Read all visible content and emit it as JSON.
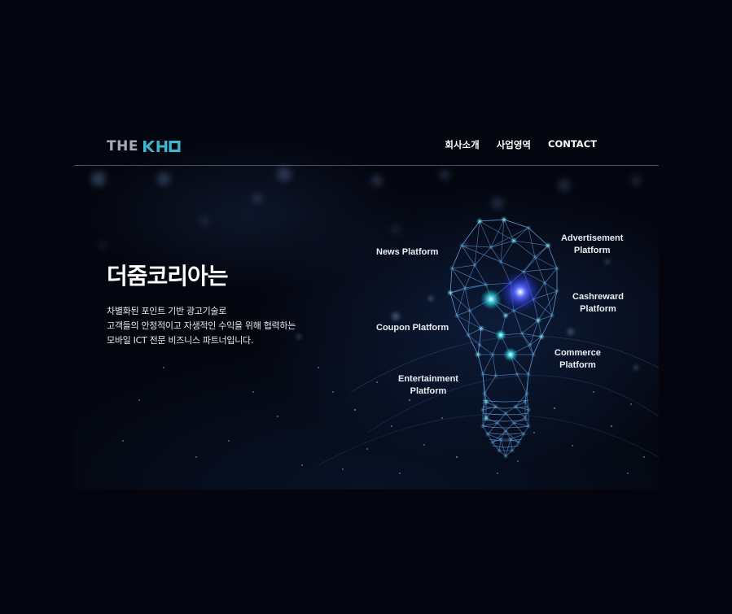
{
  "header": {
    "logo": {
      "the": "THE",
      "mark_icon": "kmo-logo-icon"
    },
    "nav": [
      "회사소개",
      "사업영역",
      "CONTACT"
    ]
  },
  "hero": {
    "title": "더줌코리아는",
    "lines": [
      "차별화된 포인트 기반 광고기술로",
      "고객들의 안정적이고 자생적인 수익을 위해 협력하는",
      "모바일 ICT 전문 비즈니스 파트너입니다."
    ]
  },
  "platforms": {
    "news": [
      "News Platform"
    ],
    "advertisement": [
      "Advertisement",
      "Platform"
    ],
    "cashreward": [
      "Cashreward",
      "Platform"
    ],
    "coupon": [
      "Coupon Platform"
    ],
    "commerce": [
      "Commerce",
      "Platform"
    ],
    "entertainment": [
      "Entertainment",
      "Platform"
    ]
  },
  "colors": {
    "background": "#04050f",
    "logo_gray": "#a6acb5",
    "logo_accent": "#3fb8cf",
    "network_line": "#6aa6e8",
    "network_node": "#5fe0f0",
    "glow_center": "#3a4cff"
  }
}
